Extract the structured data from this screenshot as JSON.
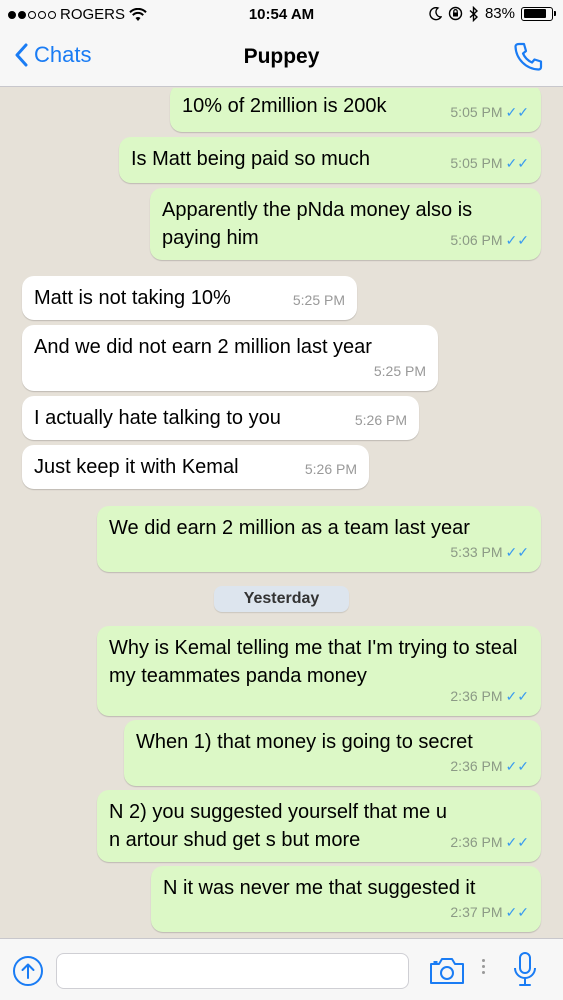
{
  "status_bar": {
    "carrier": "ROGERS",
    "time": "10:54 AM",
    "battery_text": "83%",
    "battery_level": 0.83
  },
  "nav": {
    "back_label": "Chats",
    "title": "Puppey"
  },
  "messages": [
    {
      "dir": "out",
      "text": "10% of 2million is 200k",
      "time": "5:05 PM"
    },
    {
      "dir": "out",
      "text": "Is Matt being paid so much",
      "time": "5:05 PM"
    },
    {
      "dir": "out",
      "text": "Apparently the pNda money also is paying him",
      "time": "5:06 PM"
    },
    {
      "dir": "in",
      "text": "Matt is not taking 10%",
      "time": "5:25 PM"
    },
    {
      "dir": "in",
      "text": "And we did not earn 2 million last year",
      "time": "5:25 PM"
    },
    {
      "dir": "in",
      "text": "I actually hate talking to you",
      "time": "5:26 PM"
    },
    {
      "dir": "in",
      "text": "Just keep it with Kemal",
      "time": "5:26 PM"
    },
    {
      "dir": "out",
      "text": "We did earn 2 million as a team last year",
      "time": "5:33 PM"
    },
    {
      "dir": "out",
      "text": "Why is Kemal telling me that I'm trying to steal my teammates panda money",
      "time": "2:36 PM"
    },
    {
      "dir": "out",
      "text": "When 1) that money is going to secret",
      "time": "2:36 PM"
    },
    {
      "dir": "out",
      "text": "N 2) you suggested yourself that me u n artour shud get s but more",
      "time": "2:36 PM"
    },
    {
      "dir": "out",
      "text": "N it was never me that suggested it",
      "time": "2:37 PM"
    }
  ],
  "date_divider": "Yesterday",
  "input": {
    "placeholder": ""
  },
  "colors": {
    "accent": "#1a7cf4",
    "outgoing_bubble": "#dcf8c6",
    "incoming_bubble": "#ffffff",
    "read_ticks": "#3a9bef"
  }
}
